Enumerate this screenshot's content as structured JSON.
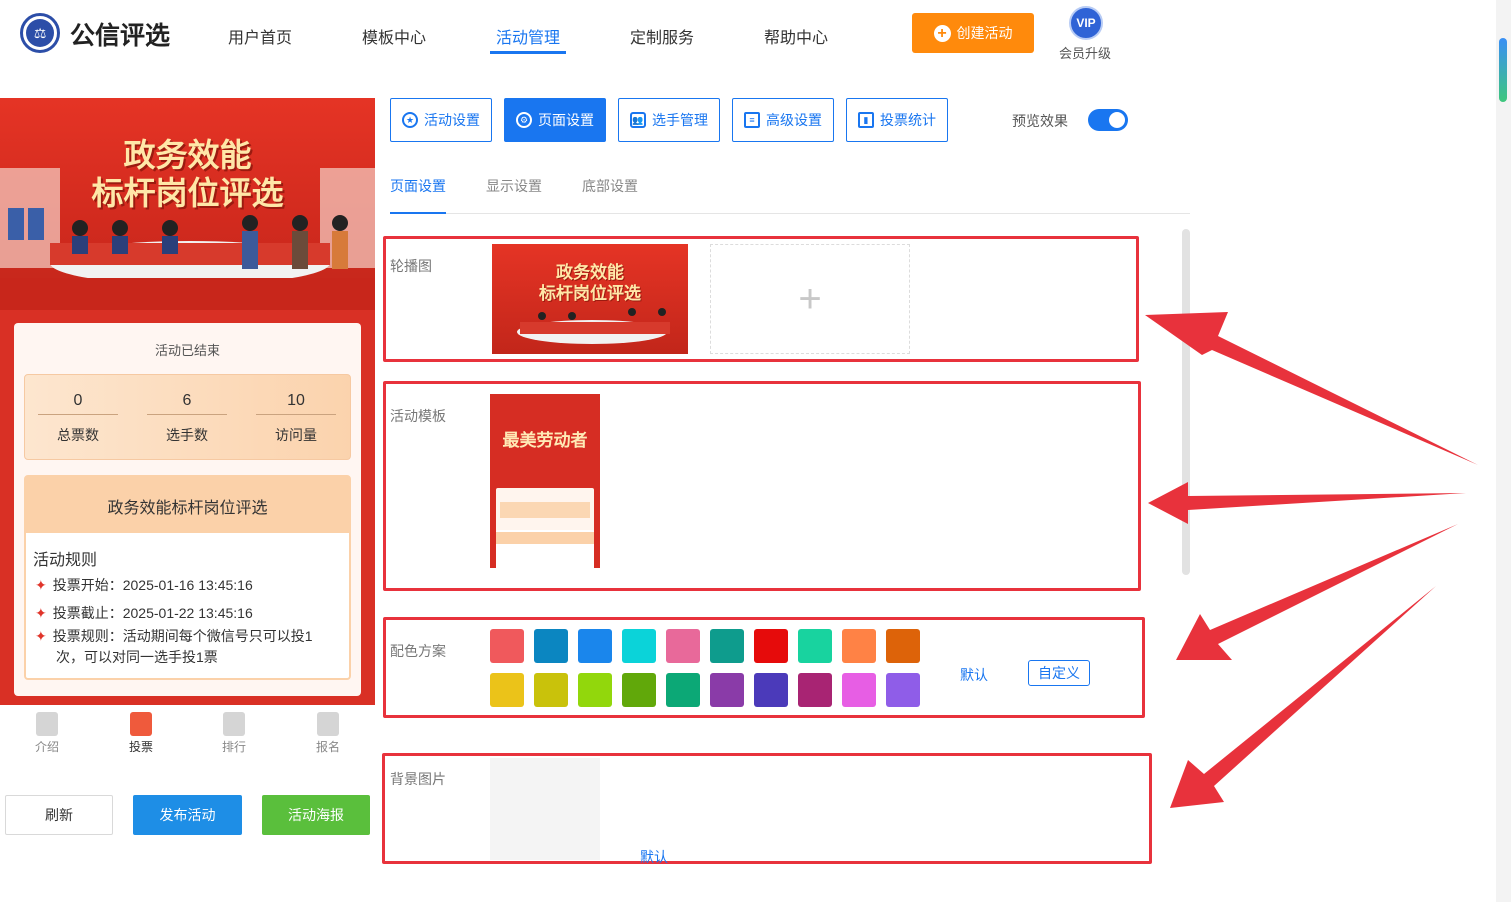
{
  "header": {
    "brand": "公信评选",
    "logo_icon": "scale-icon",
    "nav": [
      {
        "label": "用户首页",
        "active": false
      },
      {
        "label": "模板中心",
        "active": false
      },
      {
        "label": "活动管理",
        "active": true
      },
      {
        "label": "定制服务",
        "active": false
      },
      {
        "label": "帮助中心",
        "active": false
      }
    ],
    "create_label": "创建活动",
    "vip_badge": "VIP",
    "vip_label": "会员升级"
  },
  "preview": {
    "banner_line1": "政务效能",
    "banner_line2": "标杆岗位评选",
    "status": "活动已结束",
    "stats": [
      {
        "value": "0",
        "label": "总票数"
      },
      {
        "value": "6",
        "label": "选手数"
      },
      {
        "value": "10",
        "label": "访问量"
      }
    ],
    "activity_title": "政务效能标杆岗位评选",
    "rules_heading": "活动规则",
    "rules": [
      {
        "text": "投票开始：2025-01-16 13:45:16"
      },
      {
        "text": "投票截止：2025-01-22 13:45:16"
      },
      {
        "text": "投票规则：活动期间每个微信号只可以投1次，可以对同一选手投1票"
      }
    ],
    "tabs": [
      {
        "label": "介绍",
        "icon": "document-icon",
        "active": false
      },
      {
        "label": "投票",
        "icon": "home-icon",
        "active": true
      },
      {
        "label": "排行",
        "icon": "crown-icon",
        "active": false
      },
      {
        "label": "报名",
        "icon": "user-icon",
        "active": false
      }
    ],
    "buttons": {
      "refresh": "刷新",
      "publish": "发布活动",
      "poster": "活动海报"
    }
  },
  "toolbar": {
    "buttons": [
      {
        "label": "活动设置",
        "icon": "star-icon",
        "active": false
      },
      {
        "label": "页面设置",
        "icon": "gear-icon",
        "active": true
      },
      {
        "label": "选手管理",
        "icon": "users-icon",
        "active": false
      },
      {
        "label": "高级设置",
        "icon": "sliders-icon",
        "active": false
      },
      {
        "label": "投票统计",
        "icon": "bar-chart-icon",
        "active": false
      }
    ],
    "preview_label": "预览效果",
    "preview_on": true
  },
  "subtabs": [
    {
      "label": "页面设置",
      "active": true
    },
    {
      "label": "显示设置",
      "active": false
    },
    {
      "label": "底部设置",
      "active": false
    }
  ],
  "sections": {
    "carousel": {
      "label": "轮播图",
      "thumb_line1": "政务效能",
      "thumb_line2": "标杆岗位评选",
      "add_icon": "+"
    },
    "template": {
      "label": "活动模板",
      "thumb_title": "最美劳动者"
    },
    "colors": {
      "label": "配色方案",
      "default_label": "默认",
      "custom_label": "自定义",
      "row1": [
        "#f0595c",
        "#0b86c1",
        "#1a86ec",
        "#0bd3d9",
        "#e8699a",
        "#0e9c8d",
        "#e60b0b",
        "#18d39f",
        "#ff8245",
        "#dd6309"
      ],
      "row2": [
        "#ebc319",
        "#c9c20b",
        "#92d70c",
        "#61a80a",
        "#0ca876",
        "#8a3ba8",
        "#4b3aba",
        "#a82473",
        "#e75ee4",
        "#8f5de8"
      ]
    },
    "background": {
      "label": "背景图片",
      "default_label": "默认"
    }
  },
  "colors": {
    "accent": "#1976f0",
    "highlight_frame": "#e8323c",
    "create_button": "#ff8a0c"
  }
}
